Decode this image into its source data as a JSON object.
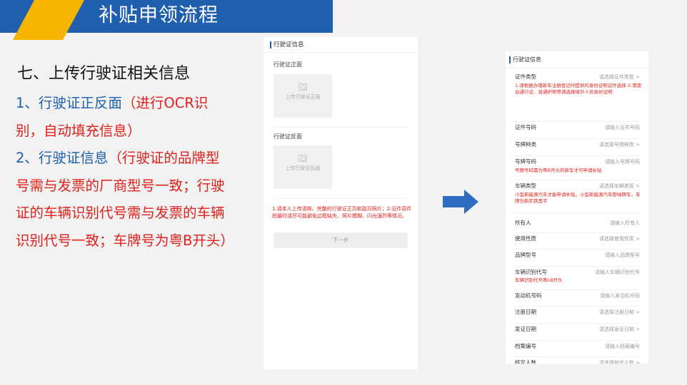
{
  "banner": {
    "title": "补贴申领流程"
  },
  "slide": {
    "heading": "七、上传行驶证相关信息",
    "point1_main": "1、行驶证正反面",
    "point1_note": "（进行OCR识别，自动填充信息）",
    "point2_main": "2、行驶证信息",
    "point2_note": "（行驶证的品牌型号需与发票的厂商型号一致；行驶证的车辆识别代号需与发票的车辆识别代号一致；车牌号为粤B开头）"
  },
  "panel1": {
    "title": "行驶证信息",
    "front_label": "行驶证正面",
    "front_upload": "上传行驶证正面",
    "back_label": "行驶证反面",
    "back_upload": "上传行驶证反面",
    "note": "1.请本人上传清晰、完整的行驶证正页和副页照片；2.证件原件拍摄时请尽可能避免边框缺失、照片模糊、闪光强烈等情况。",
    "next_button": "下一步"
  },
  "panel2": {
    "title": "行驶证信息",
    "rows": [
      {
        "label": "证件类型",
        "value": "请选择证件类型 >",
        "hint": "1.请根据办理新车注册登记时提供的身份证明证件选择 2.港澳台通行证、普通护照等请选择境外人员身份证明"
      },
      {
        "label": "证件号码",
        "value": "请输入证件号码",
        "hint": ""
      },
      {
        "label": "号牌种类",
        "value": "请选择号牌种类 >",
        "hint": ""
      },
      {
        "label": "号牌号码",
        "value": "请输入号牌号码",
        "hint": "号牌号码需为粤B开头的新车才可申请补贴"
      },
      {
        "label": "车辆类型",
        "value": "请选择车辆类型 >",
        "hint": "小型新能源汽车才能申请补贴，小型新能源汽车即绿牌车，车牌为新实铁黑字"
      },
      {
        "label": "所有人",
        "value": "请输入所有人",
        "hint": ""
      },
      {
        "label": "使用性质",
        "value": "请选择使用性质 >",
        "hint": ""
      },
      {
        "label": "品牌型号",
        "value": "请输入品牌型号",
        "hint": ""
      },
      {
        "label": "车辆识别代号",
        "value": "请输入车辆识别代号",
        "hint": "车辆识别代号粤LB开头"
      },
      {
        "label": "发动机号码",
        "value": "请输入发动机号码",
        "hint": ""
      },
      {
        "label": "注册日期",
        "value": "请选择注册日期 >",
        "hint": ""
      },
      {
        "label": "发证日期",
        "value": "请选择发证日期 >",
        "hint": ""
      },
      {
        "label": "档案编号",
        "value": "请输入档案编号",
        "hint": ""
      },
      {
        "label": "核定人数",
        "value": "请选择核定人数 >",
        "hint": ""
      }
    ]
  },
  "colors": {
    "primary": "#1f5fae",
    "accent": "#f5b400",
    "warning": "#e0201a"
  }
}
